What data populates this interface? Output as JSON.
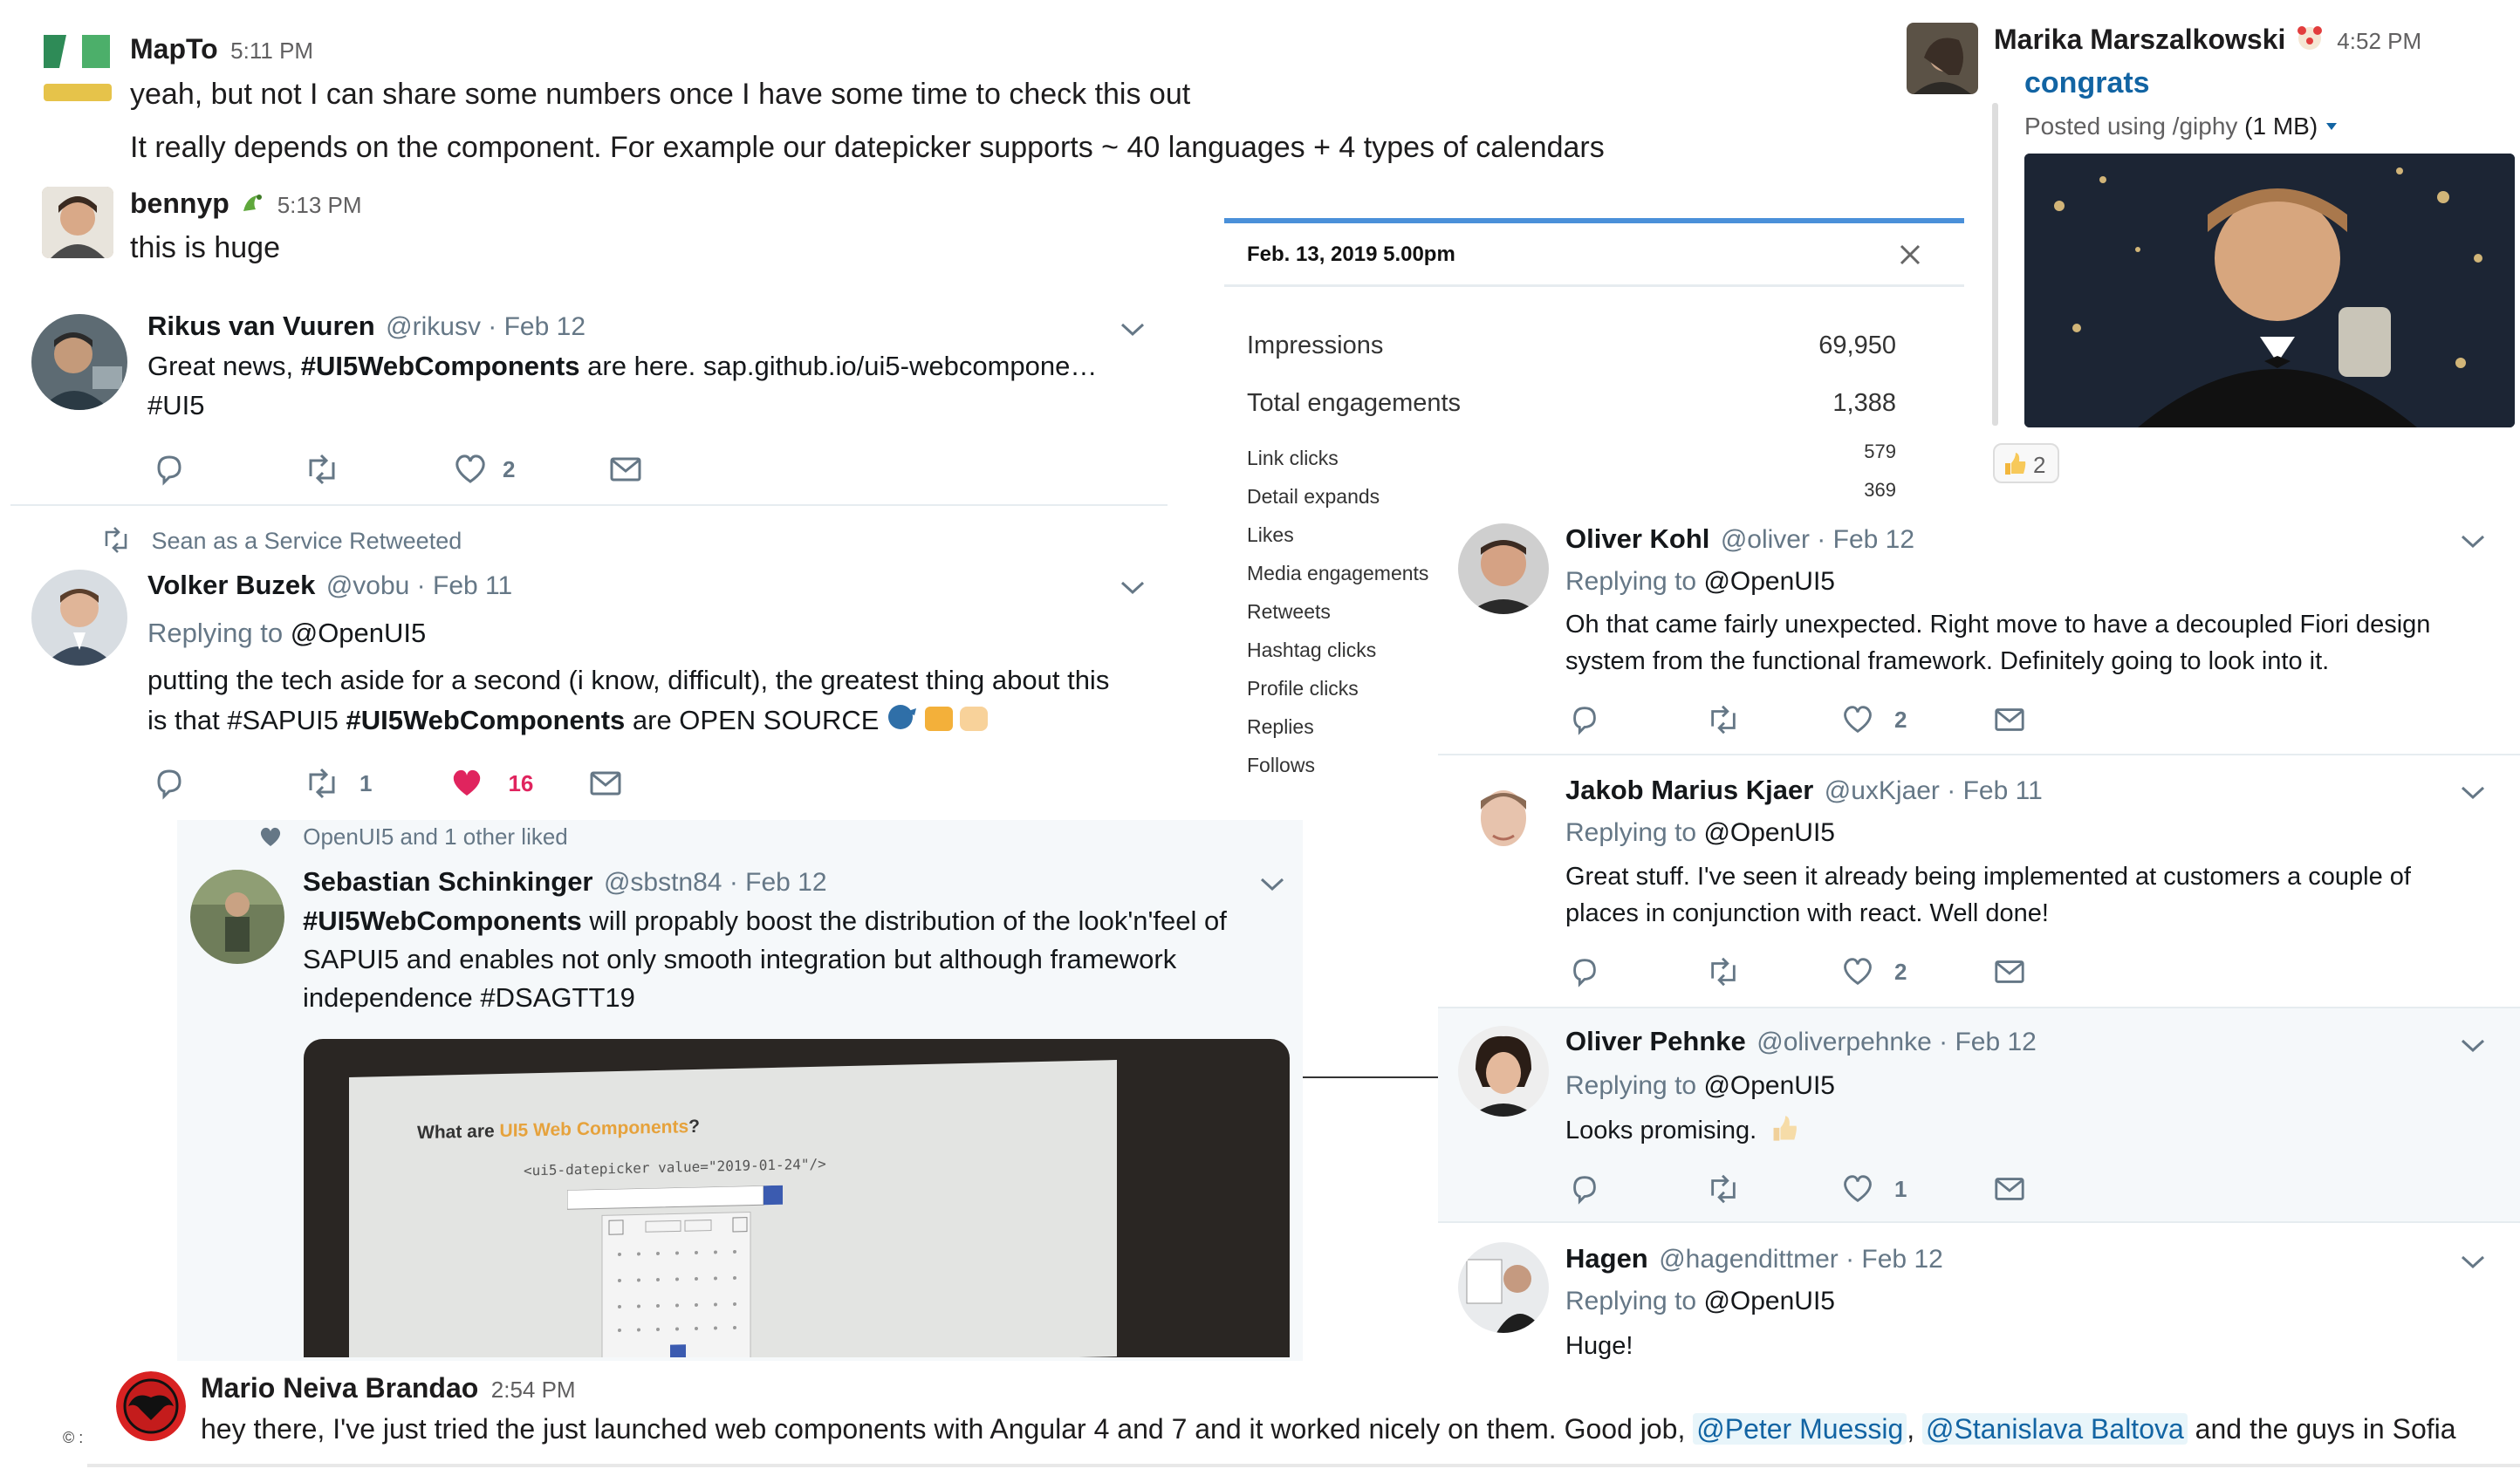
{
  "slack": {
    "mapto": {
      "name": "MapTo",
      "time": "5:11 PM",
      "line1": "yeah, but not I can share some numbers once I have some time to check this out",
      "line2": "It really depends on the component. For example our datepicker supports ~ 40 languages + 4 types of calendars"
    },
    "bennyp": {
      "name": "bennyp",
      "time": "5:13 PM",
      "text": "this is huge"
    },
    "marika": {
      "name": "Marika Marszalkowski",
      "time": "4:52 PM",
      "link": "congrats",
      "posted": "Posted using /giphy",
      "size": "(1 MB)",
      "reaction_count": "2"
    },
    "mario": {
      "name": "Mario Neiva Brandao",
      "time": "2:54 PM",
      "text_before": "hey there, I've just tried the just launched web components with Angular 4 and 7 and it worked nicely on them. Good job,",
      "mention1": "@Peter Muessig",
      "mention2": "@Stanislava Baltova",
      "text_after": "and the guys in Sofia"
    }
  },
  "tweets": {
    "rikus": {
      "name": "Rikus van Vuuren",
      "handle": "@rikusv · Feb 12",
      "text_pre": "Great news,",
      "hashtag": "#UI5WebComponents",
      "text_post": " are here. sap.github.io/ui5-webcompone…",
      "line2": "#UI5",
      "likes": "2"
    },
    "retweet_label": "Sean as a Service Retweeted",
    "volker": {
      "name": "Volker Buzek",
      "handle": "@vobu · Feb 11",
      "replying": "Replying to",
      "reply_to": "@OpenUI5",
      "line1": "putting the tech aside for a second (i know, difficult), the greatest thing about this",
      "line2_pre": "is that #SAPUI5",
      "line2_hashtag": "#UI5WebComponents",
      "line2_post": "are OPEN SOURCE",
      "retweets": "1",
      "likes": "16"
    },
    "liked_label": "OpenUI5 and 1 other liked",
    "sebastian": {
      "name": "Sebastian Schinkinger",
      "handle": "@sbstn84 · Feb 12",
      "hashtag": "#UI5WebComponents",
      "line1_post": "will propably boost the distribution of the look'n'feel of",
      "line2": "SAPUI5 and enables not only smooth integration but although framework",
      "line3": "independence #DSAGTT19",
      "slide_title": "What are",
      "slide_accent": "UI5 Web Components",
      "slide_q": "?",
      "slide_code": "<ui5-datepicker value=\"2019-01-24\"/>"
    },
    "oliverk": {
      "name": "Oliver Kohl",
      "handle": "@oliver · Feb 12",
      "replying": "Replying to",
      "reply_to": "@OpenUI5",
      "line1": "Oh that came fairly unexpected. Right move to have a decoupled Fiori design",
      "line2": "system from the functional framework. Definitely going to look into it.",
      "likes": "2"
    },
    "jakob": {
      "name": "Jakob Marius Kjaer",
      "handle": "@uxKjaer · Feb 11",
      "replying": "Replying to",
      "reply_to": "@OpenUI5",
      "line1": "Great stuff. I've seen it already being implemented at customers a couple of",
      "line2": "places in conjunction with react. Well done!",
      "likes": "2"
    },
    "oliverp": {
      "name": "Oliver Pehnke",
      "handle": "@oliverpehnke · Feb 12",
      "replying": "Replying to",
      "reply_to": "@OpenUI5",
      "text": "Looks promising.",
      "likes": "1"
    },
    "hagen": {
      "name": "Hagen",
      "handle": "@hagendittmer · Feb 12",
      "replying": "Replying to",
      "reply_to": "@OpenUI5",
      "text": "Huge!"
    }
  },
  "analytics": {
    "date": "Feb. 13, 2019 5.00pm",
    "rows": [
      {
        "label": "Impressions",
        "value": "69,950"
      },
      {
        "label": "Total engagements",
        "value": "1,388"
      }
    ],
    "small_rows": [
      {
        "label": "Link clicks",
        "value": "579"
      },
      {
        "label": "Detail expands",
        "value": "369"
      },
      {
        "label": "Likes",
        "value": ""
      },
      {
        "label": "Media engagements",
        "value": ""
      },
      {
        "label": "Retweets",
        "value": ""
      },
      {
        "label": "Hashtag clicks",
        "value": ""
      },
      {
        "label": "Profile clicks",
        "value": ""
      },
      {
        "label": "Replies",
        "value": ""
      },
      {
        "label": "Follows",
        "value": ""
      }
    ]
  },
  "footer_mark": "© :",
  "colors": {
    "twitter_gray": "#657786",
    "slack_link": "#1264a3",
    "analytics_accent": "#4a90d9",
    "heart_red": "#e0245e"
  }
}
